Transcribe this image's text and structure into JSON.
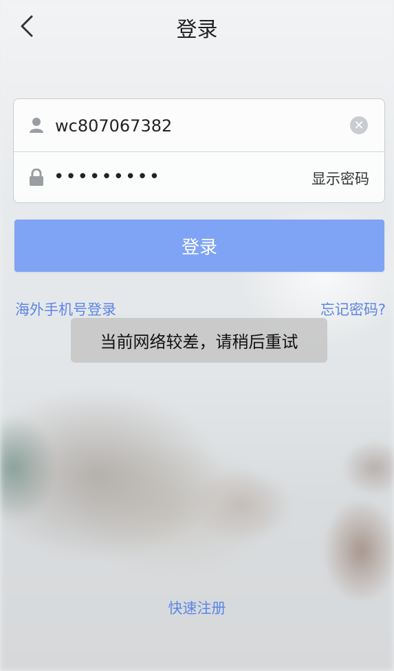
{
  "header": {
    "title": "登录",
    "back_icon": "chevron-left-icon"
  },
  "form": {
    "username": {
      "value": "wc807067382",
      "icon": "user-icon",
      "clear_icon": "clear-icon"
    },
    "password": {
      "masked_value": "•••••••••",
      "icon": "lock-icon",
      "show_label": "显示密码"
    }
  },
  "login_button": {
    "label": "登录"
  },
  "links": {
    "overseas": "海外手机号登录",
    "forgot": "忘记密码?",
    "register": "快速注册"
  },
  "toast": {
    "message": "当前网络较差，请稍后重试"
  },
  "colors": {
    "accent": "#7fa3f5",
    "link": "#5b86e5"
  }
}
